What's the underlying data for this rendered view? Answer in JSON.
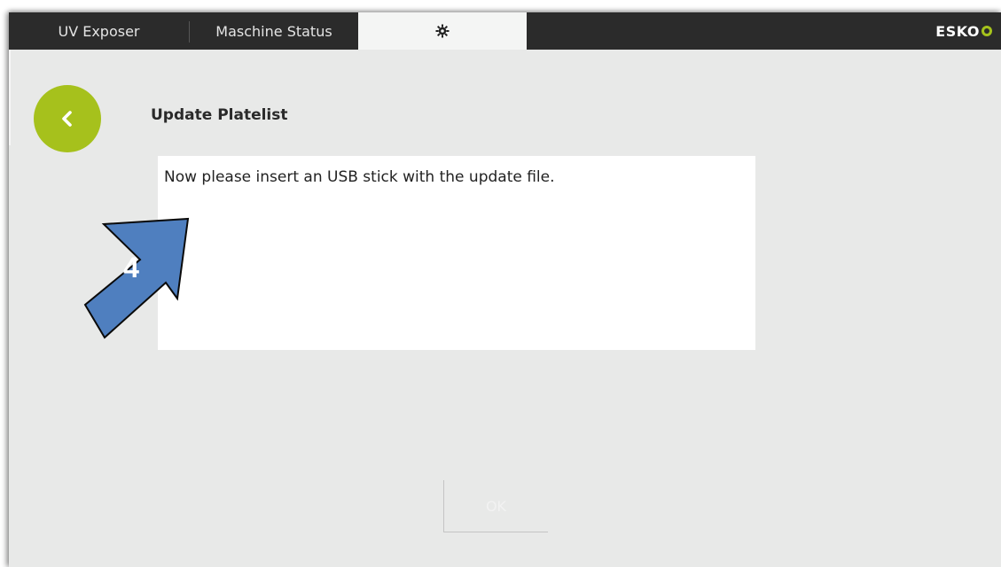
{
  "tabs": {
    "uv_exposer": "UV Exposer",
    "machine_status": "Maschine Status",
    "settings_icon": "gear-icon"
  },
  "brand": {
    "logo_text": "ESKO",
    "accent": "#a6c11c"
  },
  "page": {
    "back_icon": "chevron-left-icon",
    "title": "Update Platelist",
    "message": "Now please insert an USB stick with the update file.",
    "ok_label": "OK"
  },
  "annotation": {
    "step_number": "4",
    "arrow_color": "#4f7fbf"
  }
}
